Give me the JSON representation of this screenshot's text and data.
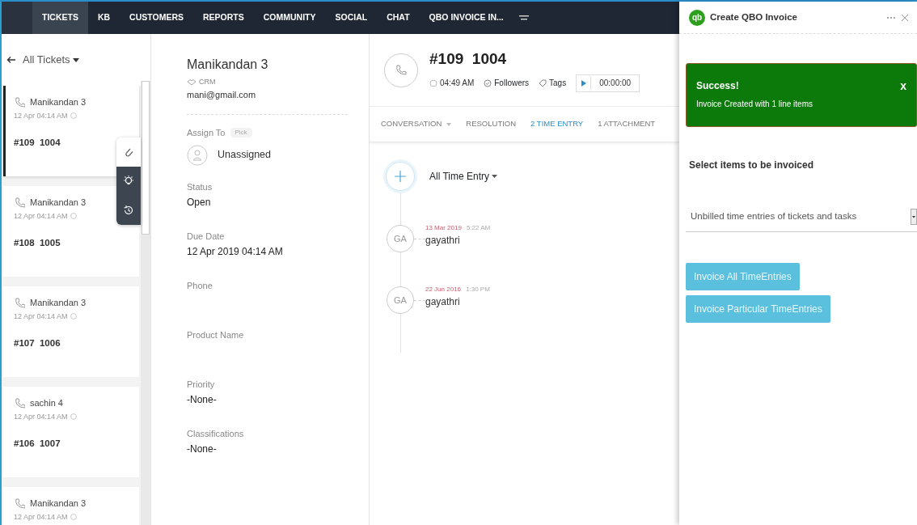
{
  "nav": {
    "items": [
      {
        "label": "TICKETS",
        "selected": true
      },
      {
        "label": "KB",
        "selected": false
      },
      {
        "label": "CUSTOMERS",
        "selected": false
      },
      {
        "label": "REPORTS",
        "selected": false
      },
      {
        "label": "COMMUNITY",
        "selected": false
      },
      {
        "label": "SOCIAL",
        "selected": false
      },
      {
        "label": "CHAT",
        "selected": false
      },
      {
        "label": "QBO INVOICE IN...",
        "selected": false
      }
    ]
  },
  "ticket_list": {
    "view": "All Tickets",
    "tickets": [
      {
        "name": "Manikandan 3",
        "date": "12 Apr 04:14 AM",
        "title": "#109  1004",
        "selected": true
      },
      {
        "name": "Manikandan 3",
        "date": "12 Apr 04:14 AM",
        "title": "#108  1005",
        "selected": false
      },
      {
        "name": "Manikandan 3",
        "date": "12 Apr 04:14 AM",
        "title": "#107  1006",
        "selected": false
      },
      {
        "name": "sachin 4",
        "date": "12 Apr 04:14 AM",
        "title": "#106  1007",
        "selected": false
      },
      {
        "name": "Manikandan 3",
        "date": "12 Apr 04:14 AM",
        "selected": false
      }
    ]
  },
  "details": {
    "name": "Manikandan 3",
    "account": "CRM",
    "email": "mani@gmail.com",
    "assign_label": "Assign To",
    "pick": "Pick",
    "assignee": "Unassigned",
    "fields": [
      {
        "label": "Status",
        "value": "Open"
      },
      {
        "label": "Due Date",
        "value": "12 Apr 2019 04:14 AM"
      },
      {
        "label": "Phone"
      },
      {
        "label": "Product Name"
      },
      {
        "label": "Priority",
        "value": "-None-"
      },
      {
        "label": "Classifications",
        "value": "-None-"
      }
    ]
  },
  "ticket": {
    "title": "#109  1004",
    "time": "04:49 AM",
    "followers": "Followers",
    "tags": "Tags",
    "timer": "00:00:00",
    "tabs": [
      {
        "label": "CONVERSATION",
        "selected": false,
        "dropdown": true
      },
      {
        "label": "RESOLUTION",
        "selected": false
      },
      {
        "label": "2 TIME ENTRY",
        "selected": true
      },
      {
        "label": "1 ATTACHMENT",
        "selected": false
      }
    ],
    "filter": "All Time Entry",
    "entries": [
      {
        "avatar": "GA",
        "date": "13 Mar 2019",
        "time": "5:22 AM",
        "user": "gayathri"
      },
      {
        "avatar": "GA",
        "date": "22 Jun 2016",
        "time": "1:30 PM",
        "user": "gayathri"
      }
    ]
  },
  "panel": {
    "logo": "qb",
    "title": "Create QBO Invoice",
    "alert": {
      "title": "Success!",
      "message": "Invoice Created with 1 line items",
      "close": "x"
    },
    "select_label": "Select items to be invoiced",
    "select_value": "Unbilled time entries of tickets and tasks",
    "buttons": [
      "Invoice All TimeEntries",
      "Invoice Particular TimeEntries"
    ]
  }
}
